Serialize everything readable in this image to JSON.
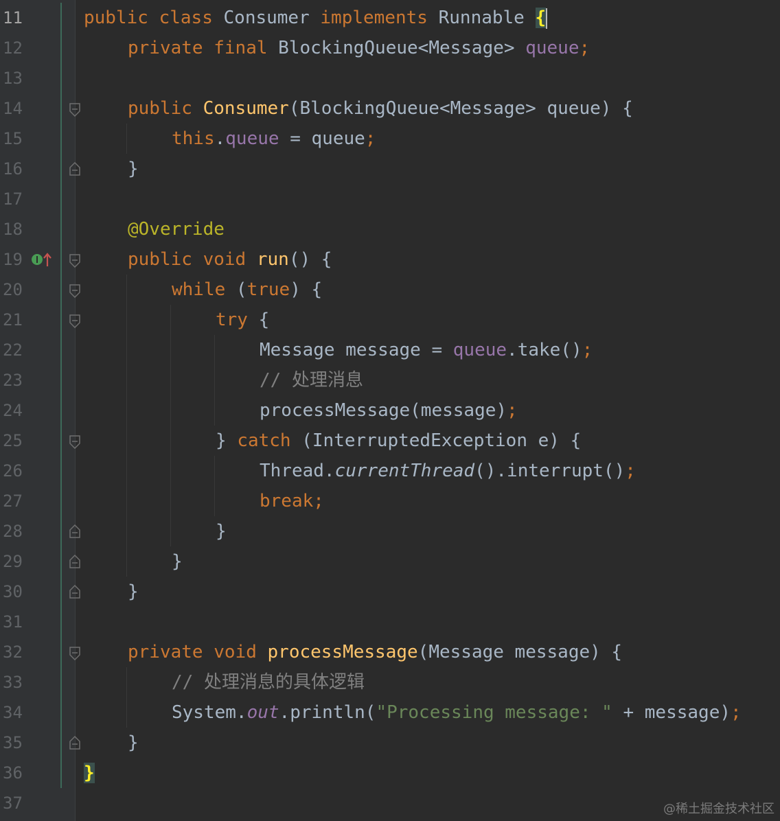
{
  "editor": {
    "current_line": "11",
    "line_numbers": [
      "11",
      "12",
      "13",
      "14",
      "15",
      "16",
      "17",
      "18",
      "19",
      "20",
      "21",
      "22",
      "23",
      "24",
      "25",
      "26",
      "27",
      "28",
      "29",
      "30",
      "31",
      "32",
      "33",
      "34",
      "35",
      "36",
      "37"
    ],
    "lines": {
      "l11": [
        "public",
        "class",
        "Consumer",
        "implements",
        "Runnable",
        "{"
      ],
      "l12": [
        "private",
        "final",
        "BlockingQueue<Message>",
        "queue",
        ";"
      ],
      "l14": [
        "public",
        "Consumer",
        "(BlockingQueue<Message> queue) {"
      ],
      "l15": [
        "this",
        ".",
        "queue",
        " = queue",
        ";"
      ],
      "l16": [
        "}"
      ],
      "l18": [
        "@Override"
      ],
      "l19": [
        "public",
        "void",
        "run",
        "() {"
      ],
      "l20": [
        "while",
        " (",
        "true",
        ") {"
      ],
      "l21": [
        "try",
        " {"
      ],
      "l22": [
        "Message message = ",
        "queue",
        ".take()",
        ";"
      ],
      "l23": [
        "// 处理消息"
      ],
      "l24": [
        "processMessage(message)",
        ";"
      ],
      "l25": [
        "} ",
        "catch",
        " (InterruptedException e) {"
      ],
      "l26": [
        "Thread.",
        "currentThread",
        "().interrupt()",
        ";"
      ],
      "l27": [
        "break",
        ";"
      ],
      "l28": [
        "}"
      ],
      "l29": [
        "}"
      ],
      "l30": [
        "}"
      ],
      "l32": [
        "private",
        "void",
        "processMessage",
        "(Message message) {"
      ],
      "l33": [
        "// 处理消息的具体逻辑"
      ],
      "l34": [
        "System.",
        "out",
        ".println(",
        "\"Processing message: \"",
        " + message)",
        ";"
      ],
      "l35": [
        "}"
      ],
      "l36": [
        "}"
      ]
    }
  },
  "watermark": "@稀土掘金技术社区",
  "colors": {
    "background": "#2b2b2b",
    "keyword": "#cc7832",
    "function": "#ffc66d",
    "field": "#9876aa",
    "annotation": "#bbb529",
    "string": "#6a8759",
    "comment": "#808080",
    "text": "#a9b7c6"
  },
  "icons": {
    "line19": "implements-method-icon"
  }
}
